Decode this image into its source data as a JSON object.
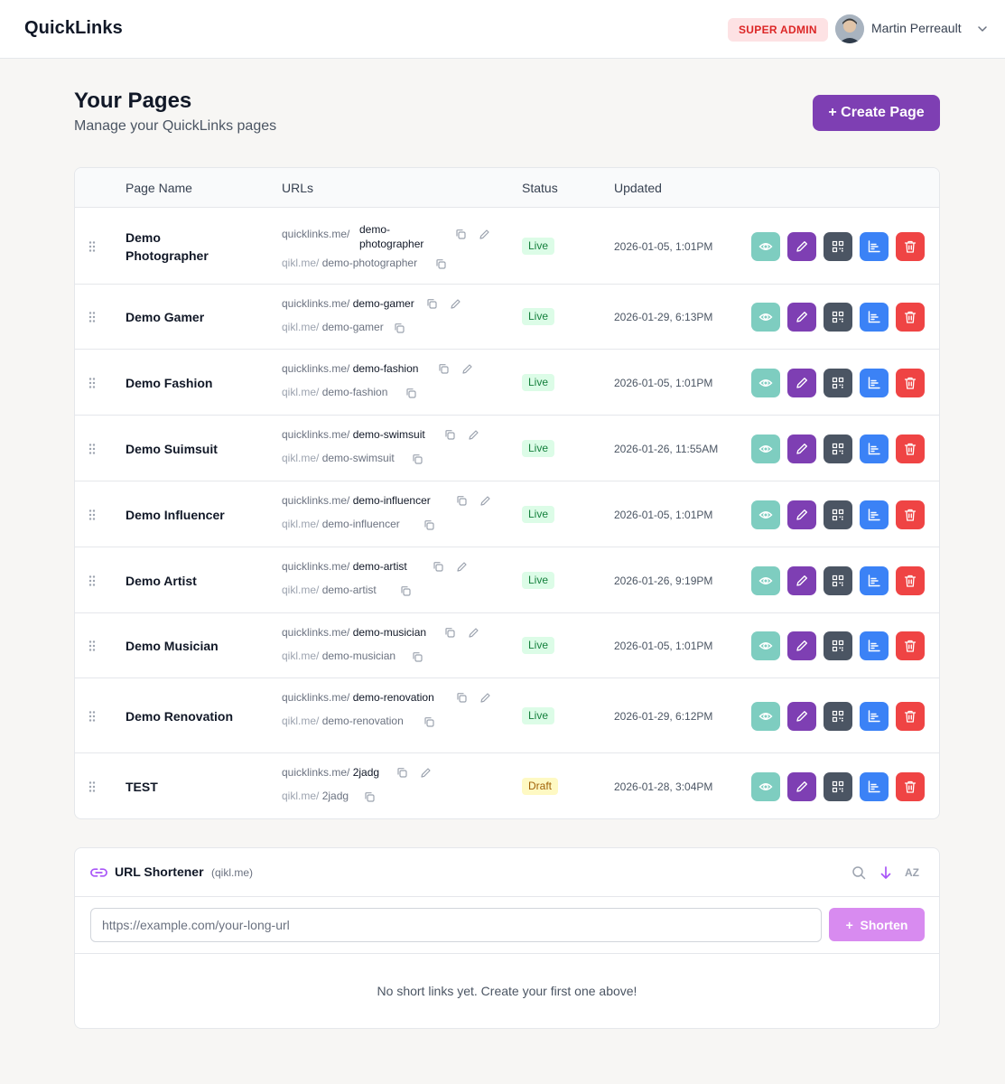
{
  "app": {
    "title": "QuickLinks"
  },
  "header": {
    "role_badge": "SUPER ADMIN",
    "user_name": "Martin Perreault"
  },
  "page": {
    "title": "Your Pages",
    "subtitle": "Manage your QuickLinks pages",
    "create_label": "+ Create Page"
  },
  "table": {
    "columns": [
      "Page Name",
      "URLs",
      "Status",
      "Updated"
    ],
    "rows": [
      {
        "name": "Demo Photographer",
        "url_prefix": "quicklinks.me/",
        "slug": "demo-photographer",
        "short_prefix": "qikl.me/",
        "short_slug": "demo-photographer",
        "status": "Live",
        "updated": "2026-01-05, 1:01PM"
      },
      {
        "name": "Demo Gamer",
        "url_prefix": "quicklinks.me/",
        "slug": "demo-gamer",
        "short_prefix": "qikl.me/",
        "short_slug": "demo-gamer",
        "status": "Live",
        "updated": "2026-01-29, 6:13PM"
      },
      {
        "name": "Demo Fashion",
        "url_prefix": "quicklinks.me/",
        "slug": "demo-fashion",
        "short_prefix": "qikl.me/",
        "short_slug": "demo-fashion",
        "status": "Live",
        "updated": "2026-01-05, 1:01PM"
      },
      {
        "name": "Demo Suimsuit",
        "url_prefix": "quicklinks.me/",
        "slug": "demo-swimsuit",
        "short_prefix": "qikl.me/",
        "short_slug": "demo-swimsuit",
        "status": "Live",
        "updated": "2026-01-26, 11:55AM"
      },
      {
        "name": "Demo Influencer",
        "url_prefix": "quicklinks.me/",
        "slug": "demo-influencer",
        "short_prefix": "qikl.me/",
        "short_slug": "demo-influencer",
        "status": "Live",
        "updated": "2026-01-05, 1:01PM"
      },
      {
        "name": "Demo Artist",
        "url_prefix": "quicklinks.me/",
        "slug": "demo-artist",
        "short_prefix": "qikl.me/",
        "short_slug": "demo-artist",
        "status": "Live",
        "updated": "2026-01-26, 9:19PM"
      },
      {
        "name": "Demo Musician",
        "url_prefix": "quicklinks.me/",
        "slug": "demo-musician",
        "short_prefix": "qikl.me/",
        "short_slug": "demo-musician",
        "status": "Live",
        "updated": "2026-01-05, 1:01PM"
      },
      {
        "name": "Demo Renovation",
        "url_prefix": "quicklinks.me/",
        "slug": "demo-renovation",
        "short_prefix": "qikl.me/",
        "short_slug": "demo-renovation",
        "status": "Live",
        "updated": "2026-01-29, 6:12PM"
      },
      {
        "name": "TEST",
        "url_prefix": "quicklinks.me/",
        "slug": "2jadg",
        "short_prefix": "qikl.me/",
        "short_slug": "2jadg",
        "status": "Draft",
        "updated": "2026-01-28, 3:04PM"
      }
    ],
    "action_icons": [
      "eye-icon",
      "pencil-icon",
      "qr-code-icon",
      "bar-chart-icon",
      "trash-icon"
    ]
  },
  "shortener": {
    "title": "URL Shortener",
    "domain": "(qikl.me)",
    "sort_label": "AZ",
    "input_placeholder": "https://example.com/your-long-url",
    "shorten_label": "Shorten",
    "empty_message": "No short links yet. Create your first one above!"
  },
  "colors": {
    "brand_purple": "#7e3fb3",
    "view_teal": "#7ecdc0",
    "qr_gray": "#4b5563",
    "stats_blue": "#3b82f6",
    "delete_red": "#ef4444",
    "live_bg": "#dcfce7",
    "draft_bg": "#fef9c3",
    "shorten_pink": "#d88bf0"
  }
}
